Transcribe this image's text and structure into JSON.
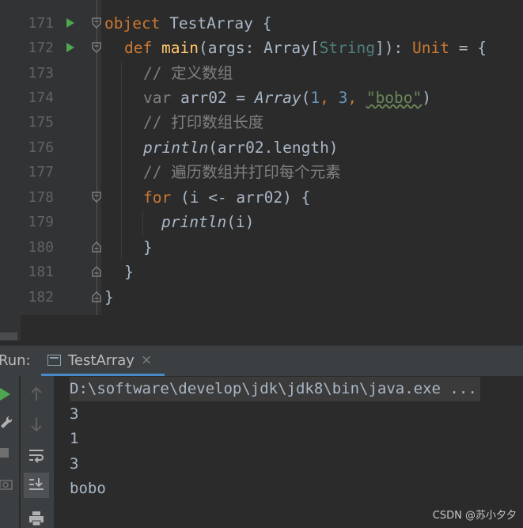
{
  "editor": {
    "lines": [
      {
        "num": "171"
      },
      {
        "num": "172"
      },
      {
        "num": "173"
      },
      {
        "num": "174"
      },
      {
        "num": "175"
      },
      {
        "num": "176"
      },
      {
        "num": "177"
      },
      {
        "num": "178"
      },
      {
        "num": "179"
      },
      {
        "num": "180"
      },
      {
        "num": "181"
      },
      {
        "num": "182"
      }
    ],
    "code": {
      "l171_kw": "object",
      "l171_name": " TestArray {",
      "l172_kw": "def",
      "l172_fn": "main",
      "l172_a": "(args: Array[",
      "l172_type": "String",
      "l172_b": "]): ",
      "l172_unit": "Unit",
      "l172_c": " = {",
      "l173_comment": "// 定义数组",
      "l174_kw": "var",
      "l174_a": " arr02 = ",
      "l174_arr": "Array",
      "l174_paren": "(",
      "l174_n1": "1",
      "l174_comma1": ", ",
      "l174_n2": "3",
      "l174_comma2": ", ",
      "l174_str": "\"bobo\"",
      "l174_close": ")",
      "l175_comment": "// 打印数组长度",
      "l176_fn": "println",
      "l176_rest": "(arr02.length)",
      "l177_comment": "// 遍历数组并打印每个元素",
      "l178_kw": "for",
      "l178_rest": " (i <- arr02) {",
      "l179_fn": "println",
      "l179_rest": "(i)",
      "l180": "}",
      "l181": "}",
      "l182": "}"
    }
  },
  "run_panel": {
    "label": "Run:",
    "tab_title": "TestArray",
    "tab_close": "×",
    "output": [
      "D:\\software\\develop\\jdk\\jdk8\\bin\\java.exe ...",
      "3",
      "1",
      "3",
      "bobo"
    ]
  },
  "watermark": "CSDN @苏小夕夕",
  "colors": {
    "keyword": "#cc7832",
    "function": "#ffc66d",
    "comment": "#808080",
    "number": "#6897bb",
    "string": "#6a8759",
    "run_green": "#4fa651",
    "tab_underline": "#4a88c7"
  }
}
